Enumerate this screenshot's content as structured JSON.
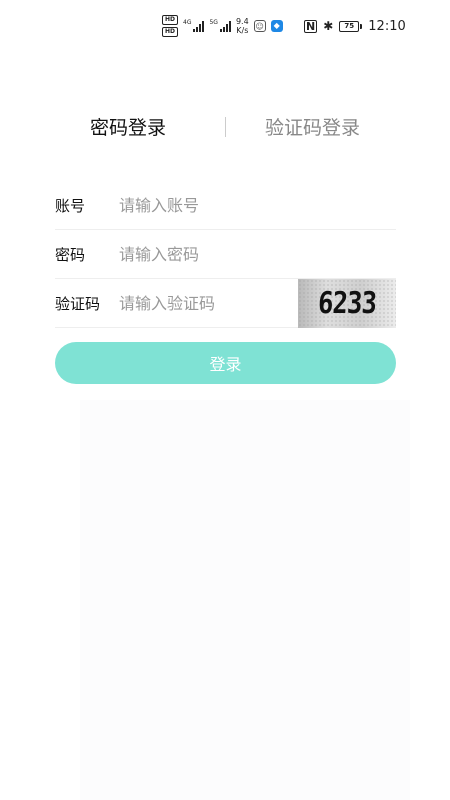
{
  "status_bar": {
    "hd1": "HD",
    "hd2": "HD",
    "net1": "4G",
    "net2": "5G",
    "speed_value": "9.4",
    "speed_unit": "K/s",
    "battery_level": "75",
    "time": "12:10"
  },
  "tabs": {
    "password_login": "密码登录",
    "code_login": "验证码登录",
    "active": "password_login"
  },
  "form": {
    "account_label": "账号",
    "account_placeholder": "请输入账号",
    "account_value": "",
    "password_label": "密码",
    "password_placeholder": "请输入密码",
    "password_value": "",
    "captcha_label": "验证码",
    "captcha_placeholder": "请输入验证码",
    "captcha_value": "",
    "captcha_image_text": "6233"
  },
  "login_button": {
    "label": "登录",
    "color": "#7fe2d4"
  }
}
